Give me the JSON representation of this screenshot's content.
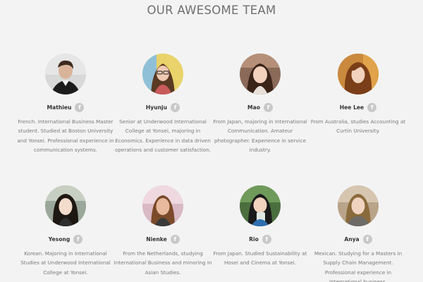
{
  "section": {
    "title": "OUR AWESOME TEAM"
  },
  "members": [
    {
      "name": "Mathieu",
      "social": "facebook-icon",
      "bio": "French. International Business Master student. Studied at Boston University and Yonsei. Professional experience in communication systems."
    },
    {
      "name": "Hyunju",
      "social": "facebook-icon",
      "bio": "Senior at Underwood International College at Yonsei, majoring in Economics. Experience in data driven operations and customer satisfaction."
    },
    {
      "name": "Mao",
      "social": "facebook-icon",
      "bio": "From Japan, majoring in International Communication. Amateur photographer. Experience in service industry."
    },
    {
      "name": "Hee Lee",
      "social": "facebook-icon",
      "bio": "From Australia, studies Accounting at Curtin University."
    },
    {
      "name": "Yesong",
      "social": "facebook-icon",
      "bio": "Korean. Majoring in International Studies at Underwood International College at Yonsei."
    },
    {
      "name": "Nienke",
      "social": "facebook-icon",
      "bio": "From the Netherlands, studying International Business and minoring in Asian Studies."
    },
    {
      "name": "Rio",
      "social": "facebook-icon",
      "bio": "From Japan. Studied Sustainability at Hosei and Cinema at Yonsei."
    },
    {
      "name": "Anya",
      "social": "facebook-icon",
      "bio": "Mexican. Studying for a Masters in Supply Chain Management. Professional experience in International business."
    }
  ],
  "colors": {
    "background": "#f3f3f3",
    "title": "#6f6f6f",
    "name": "#333333",
    "bio": "#7a7a7a",
    "social_badge": "#c9c9c9"
  }
}
